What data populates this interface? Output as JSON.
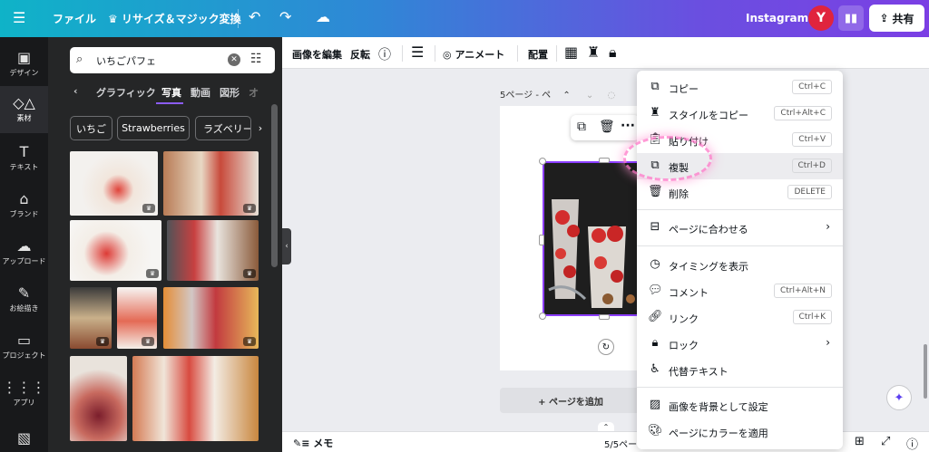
{
  "topbar": {
    "menu_icon": "hamburger-icon",
    "file": "ファイル",
    "resize": "リサイズ＆マジック変換",
    "brand_name": "Instagram",
    "avatar_initial": "Y",
    "share": "共有"
  },
  "rail": [
    {
      "label": "デザイン",
      "icon": "design-icon"
    },
    {
      "label": "素材",
      "icon": "elements-icon",
      "active": true
    },
    {
      "label": "テキスト",
      "icon": "text-icon"
    },
    {
      "label": "ブランド",
      "icon": "brand-icon"
    },
    {
      "label": "アップロード",
      "icon": "upload-icon"
    },
    {
      "label": "お絵描き",
      "icon": "draw-icon"
    },
    {
      "label": "プロジェクト",
      "icon": "folder-icon"
    },
    {
      "label": "アプリ",
      "icon": "apps-icon"
    }
  ],
  "panel": {
    "search_value": "いちごパフェ",
    "tabs": [
      "グラフィック",
      "写真",
      "動画",
      "図形",
      "オ"
    ],
    "active_tab": "写真",
    "chips": [
      "いちご",
      "Strawberries",
      "ラズベリー"
    ]
  },
  "toolbar": {
    "edit_image": "画像を編集",
    "flip": "反転",
    "animate": "アニメート",
    "position": "配置"
  },
  "page": {
    "header": "5ページ - ペ",
    "add_page": "+ ページを追加"
  },
  "bottom": {
    "memo": "メモ",
    "page_count": "5/5ペー"
  },
  "menu": [
    {
      "label": "コピー",
      "shortcut": "Ctrl+C",
      "icon": "copy-icon"
    },
    {
      "label": "スタイルをコピー",
      "shortcut": "Ctrl+Alt+C",
      "icon": "paint-roller-icon"
    },
    {
      "label": "貼り付け",
      "shortcut": "Ctrl+V",
      "icon": "clipboard-icon"
    },
    {
      "label": "複製",
      "shortcut": "Ctrl+D",
      "icon": "duplicate-icon"
    },
    {
      "label": "削除",
      "shortcut": "DELETE",
      "icon": "trash-icon"
    },
    {
      "label": "ページに合わせる",
      "icon": "fit-page-icon"
    },
    {
      "label": "タイミングを表示",
      "icon": "clock-icon"
    },
    {
      "label": "コメント",
      "shortcut": "Ctrl+Alt+N",
      "icon": "comment-icon"
    },
    {
      "label": "リンク",
      "shortcut": "Ctrl+K",
      "icon": "link-icon"
    },
    {
      "label": "ロック",
      "icon": "lock-icon"
    },
    {
      "label": "代替テキスト",
      "icon": "accessibility-icon"
    },
    {
      "label": "画像を背景として設定",
      "icon": "background-icon"
    },
    {
      "label": "ページにカラーを適用",
      "icon": "palette-icon"
    }
  ],
  "colors": {
    "accent": "#8b3dff",
    "topbar_start": "#0fb3c8",
    "topbar_end": "#7b3fe4",
    "avatar": "#e0243d"
  }
}
